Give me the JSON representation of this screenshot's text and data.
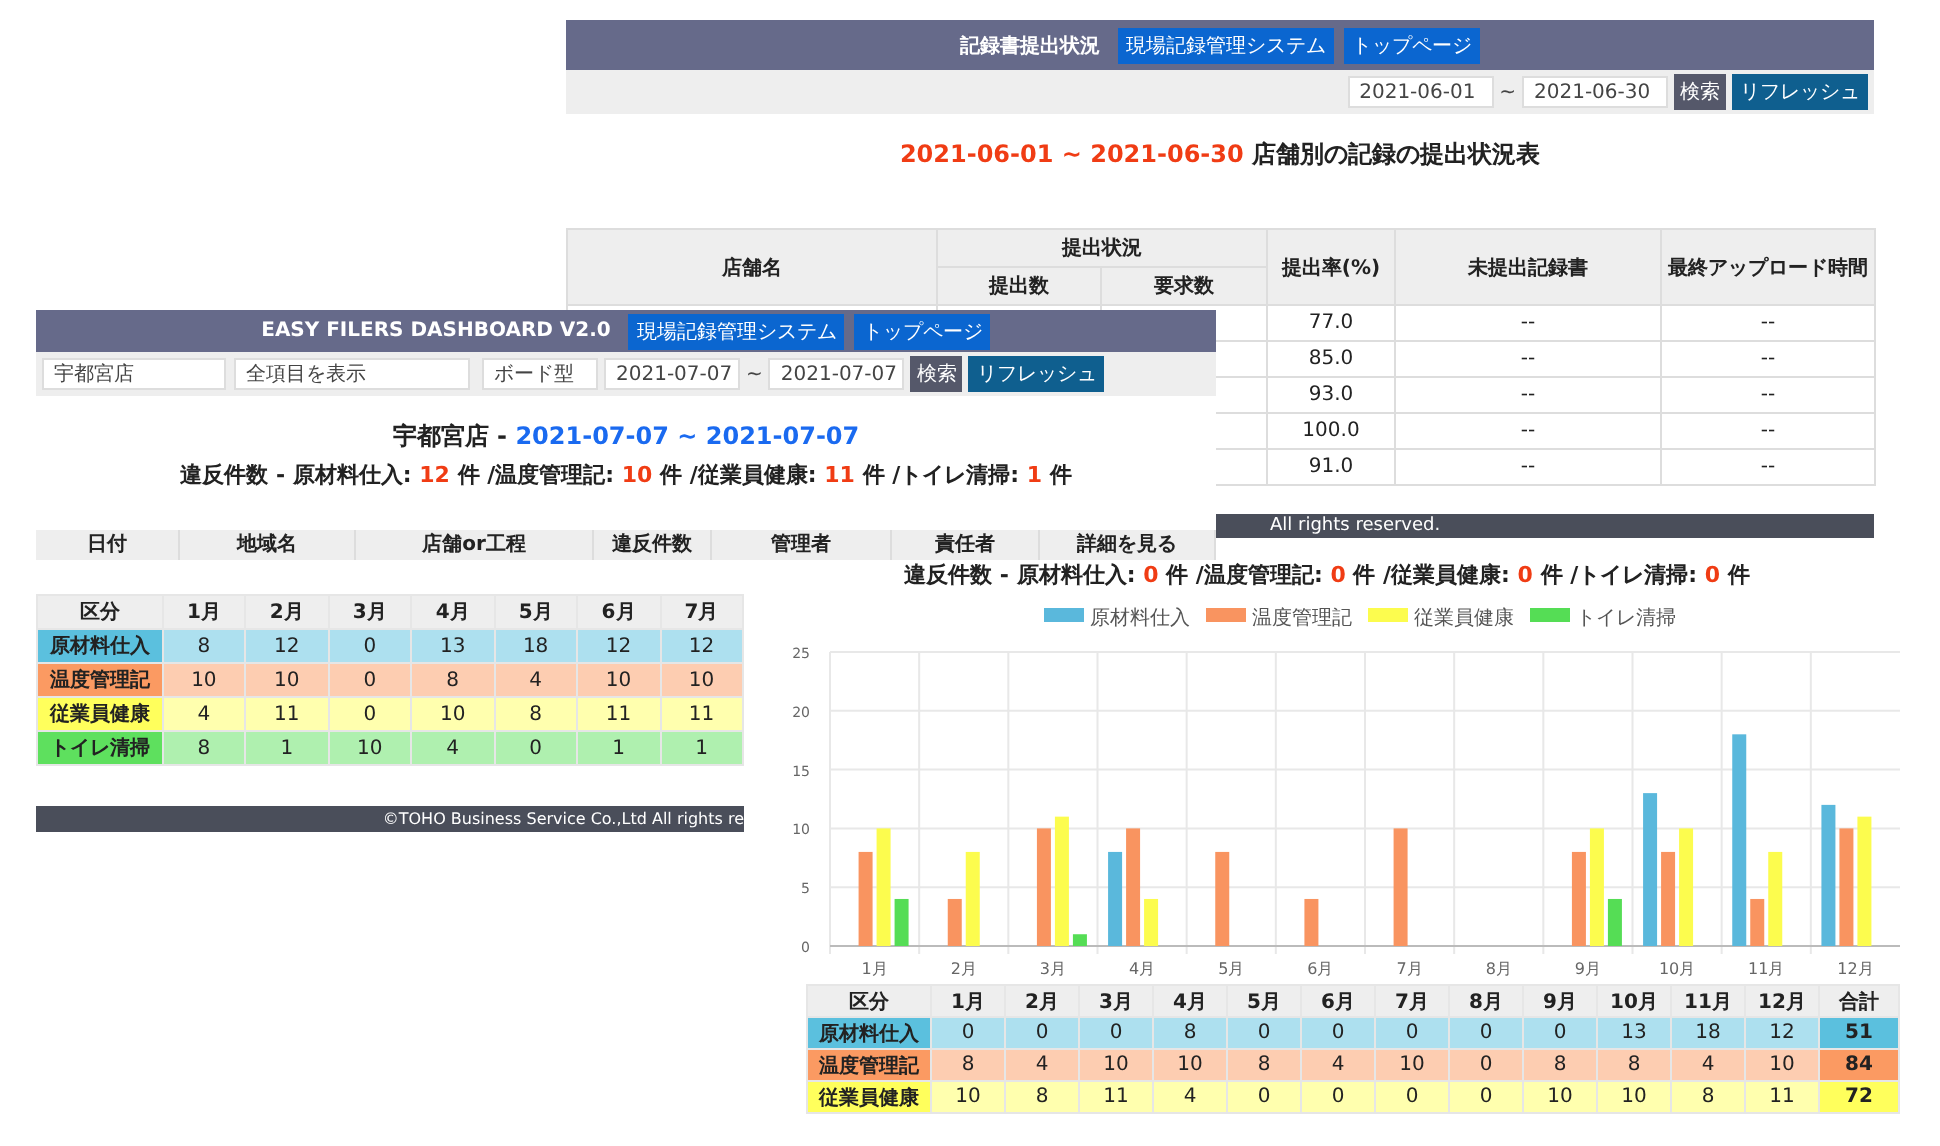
{
  "submission_window": {
    "title": "記録書提出状況",
    "nav_buttons": [
      "現場記録管理システム",
      "トップページ"
    ],
    "date_from": "2021-06-01",
    "date_separator": "~",
    "date_to": "2021-06-30",
    "search_button": "検索",
    "refresh_button": "リフレッシュ",
    "heading_dates": "2021-06-01 ~ 2021-06-30",
    "heading_text": "店舗別の記録の提出状況表",
    "table": {
      "group_label": "提出状況",
      "columns": [
        {
          "label": "店舗名",
          "grouped": false
        },
        {
          "label": "提出数",
          "grouped": true
        },
        {
          "label": "要求数",
          "grouped": true
        },
        {
          "label": "提出率(%)",
          "grouped": false
        },
        {
          "label": "未提出記録書",
          "grouped": false
        },
        {
          "label": "最終アップロード時間",
          "grouped": false
        }
      ],
      "rows": [
        [
          "",
          "",
          "",
          "77.0",
          "--",
          "--"
        ],
        [
          "",
          "",
          "",
          "85.0",
          "--",
          "--"
        ],
        [
          "",
          "",
          "",
          "93.0",
          "--",
          "--"
        ],
        [
          "",
          "",
          "",
          "100.0",
          "--",
          "--"
        ],
        [
          "",
          "",
          "",
          "91.0",
          "--",
          "--"
        ]
      ]
    },
    "footer": "All rights reserved."
  },
  "dashboard_window": {
    "title": "EASY FILERS DASHBOARD V2.0",
    "nav_buttons": [
      "現場記録管理システム",
      "トップページ"
    ],
    "filters": [
      "宇都宮店",
      "全項目を表示",
      "ボード型"
    ],
    "date_from": "2021-07-07",
    "date_separator": "~",
    "date_to": "2021-07-07",
    "search_button": "検索",
    "refresh_button": "リフレッシュ",
    "store": "宇都宮店 -",
    "period": "2021-07-07 ~ 2021-07-07",
    "violations": {
      "prefix": "違反件数 - ",
      "items": [
        {
          "label": "原材料仕入:",
          "count": "12",
          "unit": "件"
        },
        {
          "label": "/温度管理記:",
          "count": "10",
          "unit": "件"
        },
        {
          "label": "/従業員健康:",
          "count": "11",
          "unit": "件"
        },
        {
          "label": "/トイレ清掃:",
          "count": "1",
          "unit": "件"
        }
      ]
    },
    "list_columns": [
      "日付",
      "地域名",
      "店舗or工程",
      "違反件数",
      "管理者",
      "責任者",
      "詳細を見る"
    ],
    "monthly_table": {
      "columns": [
        "区分",
        "1月",
        "2月",
        "3月",
        "4月",
        "5月",
        "6月",
        "7月"
      ],
      "rows": [
        {
          "label": "原材料仕入",
          "color": "#5bc0de",
          "values": [
            "8",
            "12",
            "0",
            "13",
            "18",
            "12",
            "12"
          ]
        },
        {
          "label": "温度管理記",
          "color": "#fb9a62",
          "values": [
            "10",
            "10",
            "0",
            "8",
            "4",
            "10",
            "10"
          ]
        },
        {
          "label": "従業員健康",
          "color": "#ffff5c",
          "values": [
            "4",
            "11",
            "0",
            "10",
            "8",
            "11",
            "11"
          ]
        },
        {
          "label": "トイレ清掃",
          "color": "#5ee05e",
          "values": [
            "8",
            "1",
            "10",
            "4",
            "0",
            "1",
            "1"
          ]
        }
      ]
    },
    "footer": "©TOHO Business Service Co.,Ltd All rights re"
  },
  "chart_window": {
    "violations": {
      "prefix": "違反件数 - ",
      "items": [
        {
          "label": "原材料仕入:",
          "count": "0",
          "unit": "件"
        },
        {
          "label": "/温度管理記:",
          "count": "0",
          "unit": "件"
        },
        {
          "label": "/従業員健康:",
          "count": "0",
          "unit": "件"
        },
        {
          "label": "/トイレ清掃:",
          "count": "0",
          "unit": "件"
        }
      ]
    },
    "chart_data": {
      "type": "bar",
      "grid": true,
      "legend": true,
      "categories": [
        "1月",
        "2月",
        "3月",
        "4月",
        "5月",
        "6月",
        "7月",
        "8月",
        "9月",
        "10月",
        "11月",
        "12月"
      ],
      "ylim": [
        0,
        25
      ],
      "yticks": [
        0,
        5,
        10,
        15,
        20,
        25
      ],
      "series": [
        {
          "name": "原材料仕入",
          "color": "#5ab8dc",
          "values": [
            0,
            0,
            0,
            8,
            0,
            0,
            0,
            0,
            0,
            13,
            18,
            12
          ]
        },
        {
          "name": "温度管理記",
          "color": "#f99460",
          "values": [
            8,
            4,
            10,
            10,
            8,
            4,
            10,
            0,
            8,
            8,
            4,
            10
          ]
        },
        {
          "name": "従業員健康",
          "color": "#fcfc4e",
          "values": [
            10,
            8,
            11,
            4,
            0,
            0,
            0,
            0,
            10,
            10,
            8,
            11
          ]
        },
        {
          "name": "トイレ清掃",
          "color": "#55dd55",
          "values": [
            4,
            0,
            1,
            0,
            0,
            0,
            0,
            0,
            4,
            0,
            0,
            0
          ]
        }
      ]
    },
    "monthly_table": {
      "columns": [
        "区分",
        "1月",
        "2月",
        "3月",
        "4月",
        "5月",
        "6月",
        "7月",
        "8月",
        "9月",
        "10月",
        "11月",
        "12月",
        "合計"
      ],
      "rows": [
        {
          "label": "原材料仕入",
          "color": "#5bc0de",
          "values": [
            "0",
            "0",
            "0",
            "8",
            "0",
            "0",
            "0",
            "0",
            "0",
            "13",
            "18",
            "12"
          ],
          "total": "51"
        },
        {
          "label": "温度管理記",
          "color": "#fb9a62",
          "values": [
            "8",
            "4",
            "10",
            "10",
            "8",
            "4",
            "10",
            "0",
            "8",
            "8",
            "4",
            "10"
          ],
          "total": "84"
        },
        {
          "label": "従業員健康",
          "color": "#ffff5c",
          "values": [
            "10",
            "8",
            "11",
            "4",
            "0",
            "0",
            "0",
            "0",
            "10",
            "10",
            "8",
            "11"
          ],
          "total": "72"
        }
      ]
    }
  }
}
